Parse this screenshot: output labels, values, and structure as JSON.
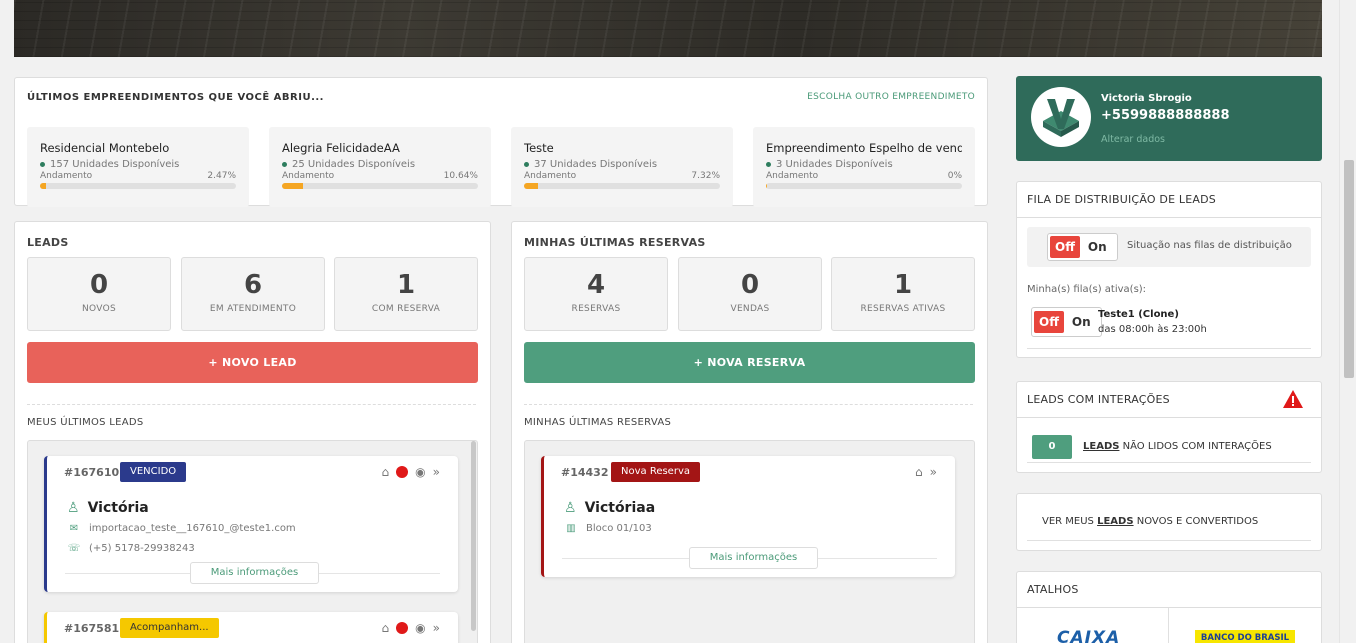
{
  "recent": {
    "title": "ÚLTIMOS EMPREENDIMENTOS QUE VOCÊ ABRIU...",
    "choose_link": "ESCOLHA OUTRO EMPREENDIMETO",
    "progress_label": "Andamento",
    "items": [
      {
        "name": "Residencial Montebelo",
        "units": "157 Unidades Disponíveis",
        "percent": "2.47%",
        "progress": 2.47
      },
      {
        "name": "Alegria FelicidadeAA",
        "units": "25 Unidades Disponíveis",
        "percent": "10.64%",
        "progress": 10.64
      },
      {
        "name": "Teste",
        "units": "37 Unidades Disponíveis",
        "percent": "7.32%",
        "progress": 7.32
      },
      {
        "name": "Empreendimento Espelho de vendas",
        "units": "3 Unidades Disponíveis",
        "percent": "0%",
        "progress": 0
      }
    ]
  },
  "leads": {
    "title": "LEADS",
    "stats": [
      {
        "value": "0",
        "label": "NOVOS"
      },
      {
        "value": "6",
        "label": "EM ATENDIMENTO"
      },
      {
        "value": "1",
        "label": "COM RESERVA"
      }
    ],
    "new_button": "+ NOVO LEAD",
    "list_title": "MEUS ÚLTIMOS LEADS",
    "cards": [
      {
        "id": "#167610",
        "badge": "VENCIDO",
        "name": "Victória",
        "email": "importacao_teste__167610_@teste1.com",
        "phone": "(+5) 5178-29938243",
        "more": "Mais informações"
      },
      {
        "id": "#167581",
        "badge": "Acompanham..."
      }
    ]
  },
  "reservas": {
    "title": "MINHAS ÚLTIMAS RESERVAS",
    "stats": [
      {
        "value": "4",
        "label": "RESERVAS"
      },
      {
        "value": "0",
        "label": "VENDAS"
      },
      {
        "value": "1",
        "label": "RESERVAS ATIVAS"
      }
    ],
    "new_button": "+ NOVA RESERVA",
    "list_title": "MINHAS ÚLTIMAS RESERVAS",
    "cards": [
      {
        "id": "#14432",
        "badge": "Nova Reserva",
        "name": "Victóriaa",
        "unit": "Bloco 01/103",
        "more": "Mais informações"
      }
    ]
  },
  "profile": {
    "name": "Victoria Sbrogio",
    "phone": "+5599888888888",
    "edit_link": "Alterar dados"
  },
  "queue": {
    "title": "FILA DE DISTRIBUIÇÃO DE LEADS",
    "toggle_off": "Off",
    "toggle_on": "On",
    "status_text": "Situação nas filas de distribuição",
    "active_label": "Minha(s) fila(s) ativa(s):",
    "active_name": "Teste1 (Clone)",
    "active_hours": "das 08:00h às 23:00h"
  },
  "interactions": {
    "title": "LEADS COM INTERAÇÕES",
    "count": "0",
    "leads_word": "LEADS",
    "text": "NÃO LIDOS COM INTERAÇÕES"
  },
  "see_leads": {
    "prefix": "VER MEUS",
    "leads_word": "LEADS",
    "suffix": "NOVOS E CONVERTIDOS"
  },
  "shortcuts": {
    "title": "ATALHOS",
    "caixa": "CAIXA",
    "bb": "BANCO DO BRASIL"
  },
  "colors": {
    "accent_green": "#4f9e7e",
    "profile_bg": "#2f6b5a",
    "danger": "#e8625a",
    "vencido": "#2b3a8c",
    "acompanhamento": "#f5c800",
    "nova_reserva": "#a31515"
  }
}
